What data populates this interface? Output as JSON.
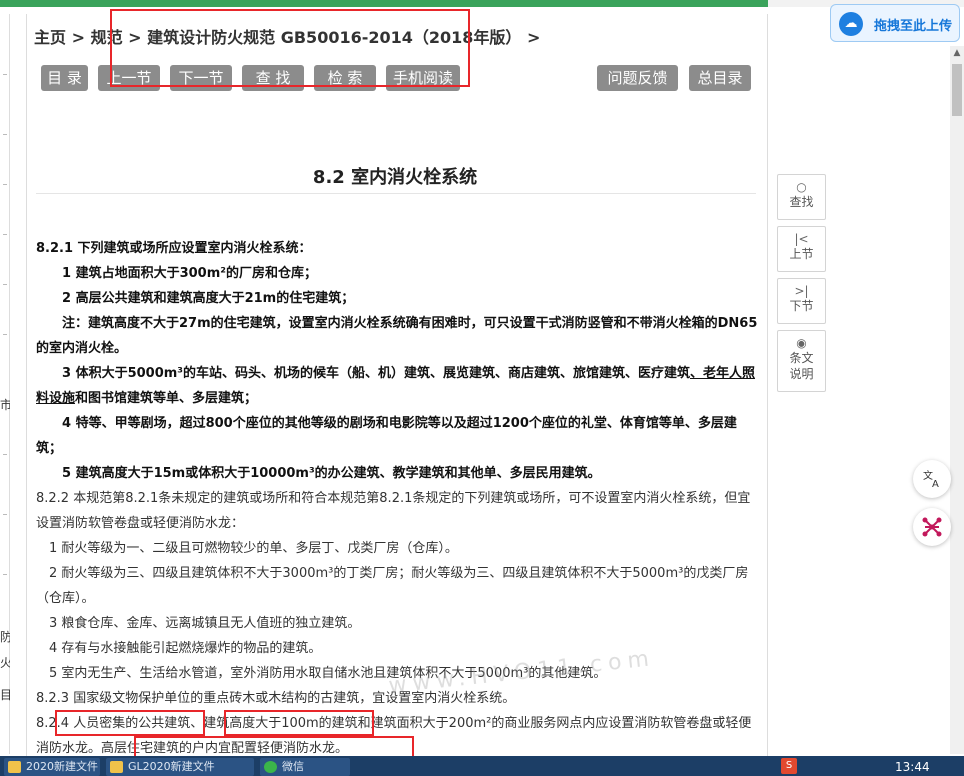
{
  "breadcrumb": {
    "home": "主页",
    "specs": "规范",
    "current": "建筑设计防火规范 GB50016-2014（2018年版）",
    "sep": ">"
  },
  "toolbar": {
    "toc": "目 录",
    "prev": "上一节",
    "next": "下一节",
    "find": "查 找",
    "search": "检 索",
    "mobile": "手机阅读",
    "feedback": "问题反馈",
    "main_toc": "总目录"
  },
  "section_title": "8.2  室内消火栓系统",
  "content": {
    "p1": "8.2.1 下列建筑或场所应设置室内消火栓系统：",
    "p2": "1 建筑占地面积大于300m²的厂房和仓库；",
    "p3": "2 高层公共建筑和建筑高度大于21m的住宅建筑；",
    "p4": "注：建筑高度不大于27m的住宅建筑，设置室内消火栓系统确有困难时，可只设置干式消防竖管和不带消火栓箱的DN65的室内消火栓。",
    "p5a": "3 体积大于5000m³的车站、码头、机场的候车（船、机）建筑、展览建筑、商店建筑、旅馆建筑、医疗建筑",
    "p5b": "、老年人照料设施",
    "p5c": "和图书馆建筑等单、多层建筑；",
    "p6": "4 特等、甲等剧场，超过800个座位的其他等级的剧场和电影院等以及超过1200个座位的礼堂、体育馆等单、多层建筑；",
    "p7": "5 建筑高度大于15m或体积大于10000m³的办公建筑、教学建筑和其他单、多层民用建筑。",
    "p8": "8.2.2 本规范第8.2.1条未规定的建筑或场所和符合本规范第8.2.1条规定的下列建筑或场所，可不设置室内消火栓系统，但宜设置消防软管卷盘或轻便消防水龙：",
    "p9": "1 耐火等级为一、二级且可燃物较少的单、多层丁、戊类厂房（仓库）。",
    "p10": "2 耐火等级为三、四级且建筑体积不大于3000m³的丁类厂房；耐火等级为三、四级且建筑体积不大于5000m³的戊类厂房（仓库）。",
    "p11": "3 粮食仓库、金库、远离城镇且无人值班的独立建筑。",
    "p12": "4 存有与水接触能引起燃烧爆炸的物品的建筑。",
    "p13": "5 室内无生产、生活给水管道，室外消防用水取自储水池且建筑体积不大于5000m³的其他建筑。",
    "p14": "8.2.3 国家级文物保护单位的重点砖木或木结构的古建筑，宜设置室内消火栓系统。",
    "p15": "8.2.4 人员密集的公共建筑、建筑高度大于100m的建筑和建筑面积大于200m²的商业服务网点内应设置消防软管卷盘或轻便消防水龙。高层住宅建筑的户内宜配置轻便消防水龙。"
  },
  "side": {
    "find": "查找",
    "prev": "上节",
    "next": "下节",
    "explain1": "条文",
    "explain2": "说明",
    "find_icon": "○",
    "prev_icon": "|<",
    "next_icon": ">|",
    "eye_icon": "◉"
  },
  "upload": {
    "label": "拖拽至此上传"
  },
  "left_frags": [
    "市",
    "防",
    "火",
    "目"
  ],
  "taskbar": {
    "item1": "2020新建文件",
    "item2": "GL2020新建文件",
    "item3": "微信",
    "clock": "13:44"
  },
  "watermark": "www.HVO11.com",
  "colors": {
    "highlight_box": "#e8262a",
    "button_bg": "#8c8c8c",
    "top_bar": "#3aa35b"
  }
}
